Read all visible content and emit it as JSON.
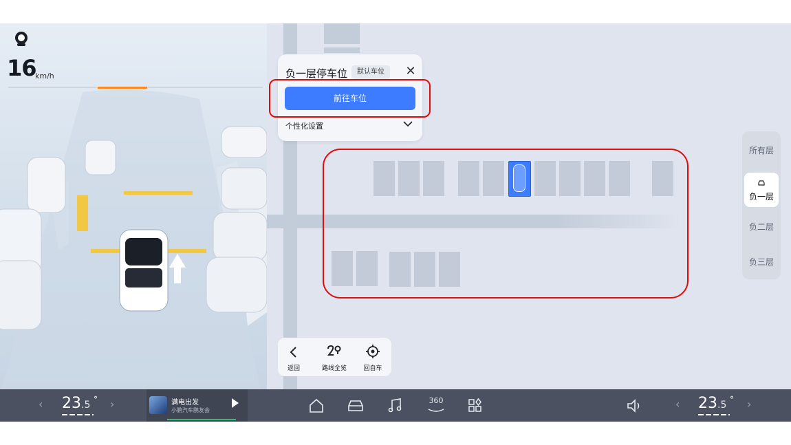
{
  "hud": {
    "avatar_icon": "avatar-icon",
    "speed": "16",
    "speed_unit": "km/h"
  },
  "parking_card": {
    "title": "负一层停车位",
    "tag": "默认车位",
    "close_icon": "close-icon",
    "go_button": "前往车位",
    "settings_label": "个性化设置",
    "settings_icon": "chevron-down-icon"
  },
  "floors": [
    {
      "label": "所有层",
      "active": false
    },
    {
      "label": "负一层",
      "active": true,
      "icon": "car-icon"
    },
    {
      "label": "负二层",
      "active": false
    },
    {
      "label": "负三层",
      "active": false
    }
  ],
  "nav_card": [
    {
      "label": "返回",
      "icon": "back-icon"
    },
    {
      "label": "路线全览",
      "icon": "route-icon"
    },
    {
      "label": "回自车",
      "icon": "locate-icon"
    }
  ],
  "bottom_bar": {
    "left_temp_main": "23",
    "left_temp_decimal": ".5",
    "right_temp_main": "23",
    "right_temp_decimal": ".5",
    "degree": "°",
    "music_title": "满电出发",
    "music_subtitle": "小鹏汽车鹏友会",
    "dock_icons": [
      "home-icon",
      "car-icon",
      "music-icon",
      "360-camera-icon",
      "apps-icon"
    ],
    "volume_icon": "volume-icon",
    "camera_label": "360"
  },
  "colors": {
    "accent": "#3d7cff",
    "highlight": "#e00b0b",
    "speed_bar": "#ff8a1f",
    "bar_bg": "#4b5160"
  }
}
